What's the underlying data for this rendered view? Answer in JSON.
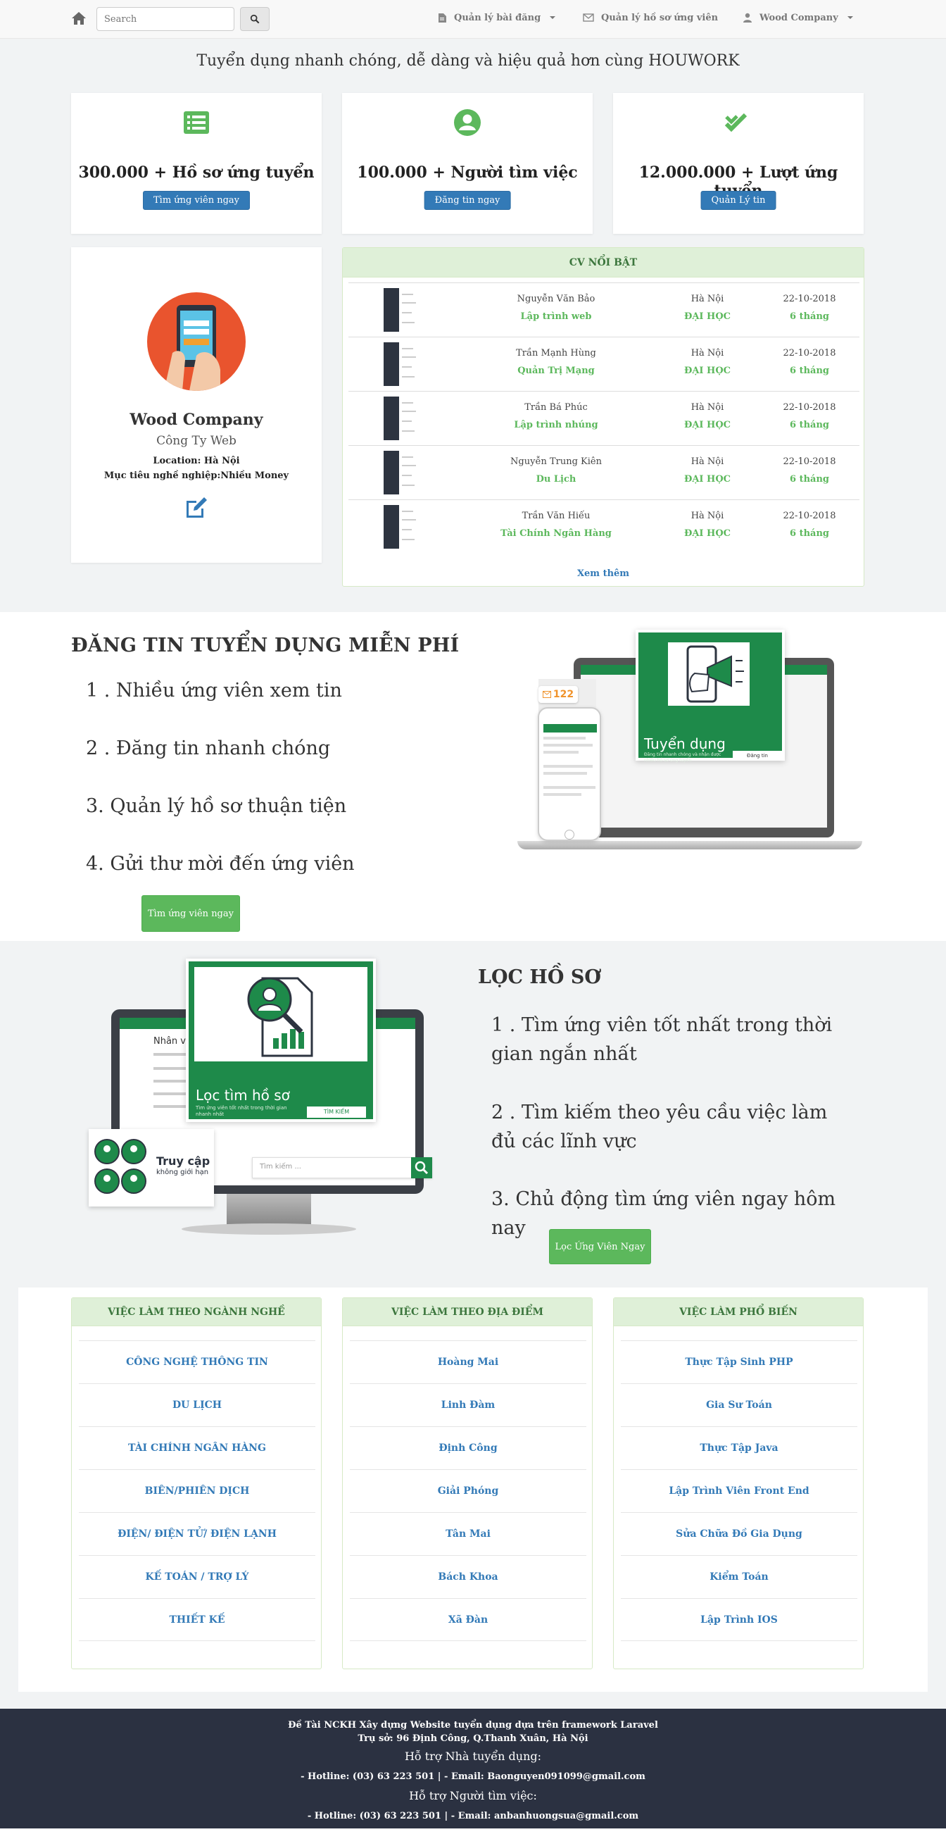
{
  "navbar": {
    "search_placeholder": "Search",
    "manage_posts": "Quản lý bài đăng",
    "manage_applications": "Quản lý hồ sơ ứng viên",
    "account": "Wood Company"
  },
  "tagline": "Tuyển dụng nhanh chóng, dễ dàng và hiệu quả hơn cùng HOUWORK",
  "stats": [
    {
      "text": "300.000 + Hồ sơ ứng tuyển",
      "button": "Tìm ứng viên ngay"
    },
    {
      "text": "100.000 + Người tìm việc",
      "button": "Đăng tin ngay"
    },
    {
      "text": "12.000.000 + Lượt ứng tuyển",
      "button": "Quản Lý tin"
    }
  ],
  "profile": {
    "name": "Wood Company",
    "type": "Công Ty Web",
    "location": "Location: Hà Nội",
    "goal": "Mục tiêu nghề nghiệp:Nhiều Money"
  },
  "cv_panel": {
    "heading": "CV NỔI BẬT",
    "rows": [
      {
        "name": "Nguyễn Văn Bảo",
        "job": "Lập trình web",
        "city": "Hà Nội",
        "edu": "ĐẠI HỌC",
        "date": "22-10-2018",
        "exp": "6 tháng"
      },
      {
        "name": "Trần Mạnh Hùng",
        "job": "Quản Trị Mạng",
        "city": "Hà Nội",
        "edu": "ĐẠI HỌC",
        "date": "22-10-2018",
        "exp": "6 tháng"
      },
      {
        "name": "Trần Bá Phúc",
        "job": "Lập trình nhúng",
        "city": "Hà Nội",
        "edu": "ĐẠI HỌC",
        "date": "22-10-2018",
        "exp": "6 tháng"
      },
      {
        "name": "Nguyễn Trung Kiên",
        "job": "Du Lịch",
        "city": "Hà Nội",
        "edu": "ĐẠI HỌC",
        "date": "22-10-2018",
        "exp": "6 tháng"
      },
      {
        "name": "Trần Văn Hiếu",
        "job": "Tài Chính Ngân Hàng",
        "city": "Hà Nội",
        "edu": "ĐẠI HỌC",
        "date": "22-10-2018",
        "exp": "6 tháng"
      }
    ],
    "more": "Xem thêm"
  },
  "promo_post": {
    "title": "ĐĂNG TIN TUYỂN DỤNG MIỄN PHÍ",
    "items": [
      "1 . Nhiều ứng viên xem tin",
      "2 . Đăng tin nhanh chóng",
      "3. Quản lý hồ sơ thuận tiện",
      "4. Gửi thư mời đến ứng viên"
    ],
    "button": "Tìm ứng viên ngay",
    "illus_badge": "122",
    "illus_title": "Tuyển dụng",
    "illus_sub": "Đăng tin nhanh chóng và nhận được nhiều hồ sơ ứng tuyển",
    "illus_btn": "Đăng tin"
  },
  "promo_filter": {
    "title": "LỌC HỒ SƠ",
    "items": [
      "1 . Tìm ứng viên tốt nhất trong thời gian ngắn nhất",
      "2 . Tìm kiếm theo yêu cầu việc làm đủ các lĩnh vực",
      "3. Chủ động tìm ứng viên ngay hôm nay"
    ],
    "button": "Lọc Ứng Viên Ngay",
    "illus_title": "Lọc tìm hồ sơ",
    "illus_sub": "Tìm ứng viên tốt nhất trong thời gian nhanh nhất",
    "illus_btn": "TÌM KIẾM",
    "illus_search": "Tìm kiếm ...",
    "illus_access_1": "Truy cập",
    "illus_access_2": "không giới hạn",
    "illus_screen_title": "Nhân viên"
  },
  "job_lists": [
    {
      "heading": "VIỆC LÀM THEO NGÀNH NGHỀ",
      "items": [
        "CÔNG NGHỆ THÔNG TIN",
        "DU LỊCH",
        "TÀI CHÍNH NGÂN HÀNG",
        "BIÊN/PHIÊN DỊCH",
        "ĐIỆN/ ĐIỆN TỬ/ ĐIỆN LẠNH",
        "KẾ TOÁN / TRỢ LÝ",
        "THIẾT KẾ"
      ]
    },
    {
      "heading": "VIỆC LÀM THEO ĐỊA ĐIỂM",
      "items": [
        "Hoàng Mai",
        "Linh Đàm",
        "Định Công",
        "Giải Phóng",
        "Tân Mai",
        "Bách Khoa",
        "Xã Đàn"
      ]
    },
    {
      "heading": "VIỆC LÀM PHỔ BIẾN",
      "items": [
        "Thực Tập Sinh PHP",
        "Gia Sư Toán",
        "Thực Tập Java",
        "Lập Trình Viên Front End",
        "Sửa Chữa Đồ Gia Dụng",
        "Kiểm Toán",
        "Lập Trình IOS"
      ]
    }
  ],
  "footer": {
    "line1": "Đề Tài NCKH Xây dựng Website tuyển dụng dựa trên framework Laravel",
    "line2": "Trụ sở: 96 Định Công, Q.Thanh Xuân, Hà Nội",
    "line3": "Hỗ trợ Nhà tuyển dụng:",
    "line4": "- Hotline: (03) 63 223 501 | - Email: Baonguyen091099@gmail.com",
    "line5": "Hỗ trợ Người tìm việc:",
    "line6": "- Hotline: (03) 63 223 501 | - Email: anbanhuongsua@gmail.com"
  },
  "colors": {
    "primary": "#337ab7",
    "success": "#5cb85c",
    "brand_green": "#1e8a4a",
    "footer": "#2b3141"
  }
}
